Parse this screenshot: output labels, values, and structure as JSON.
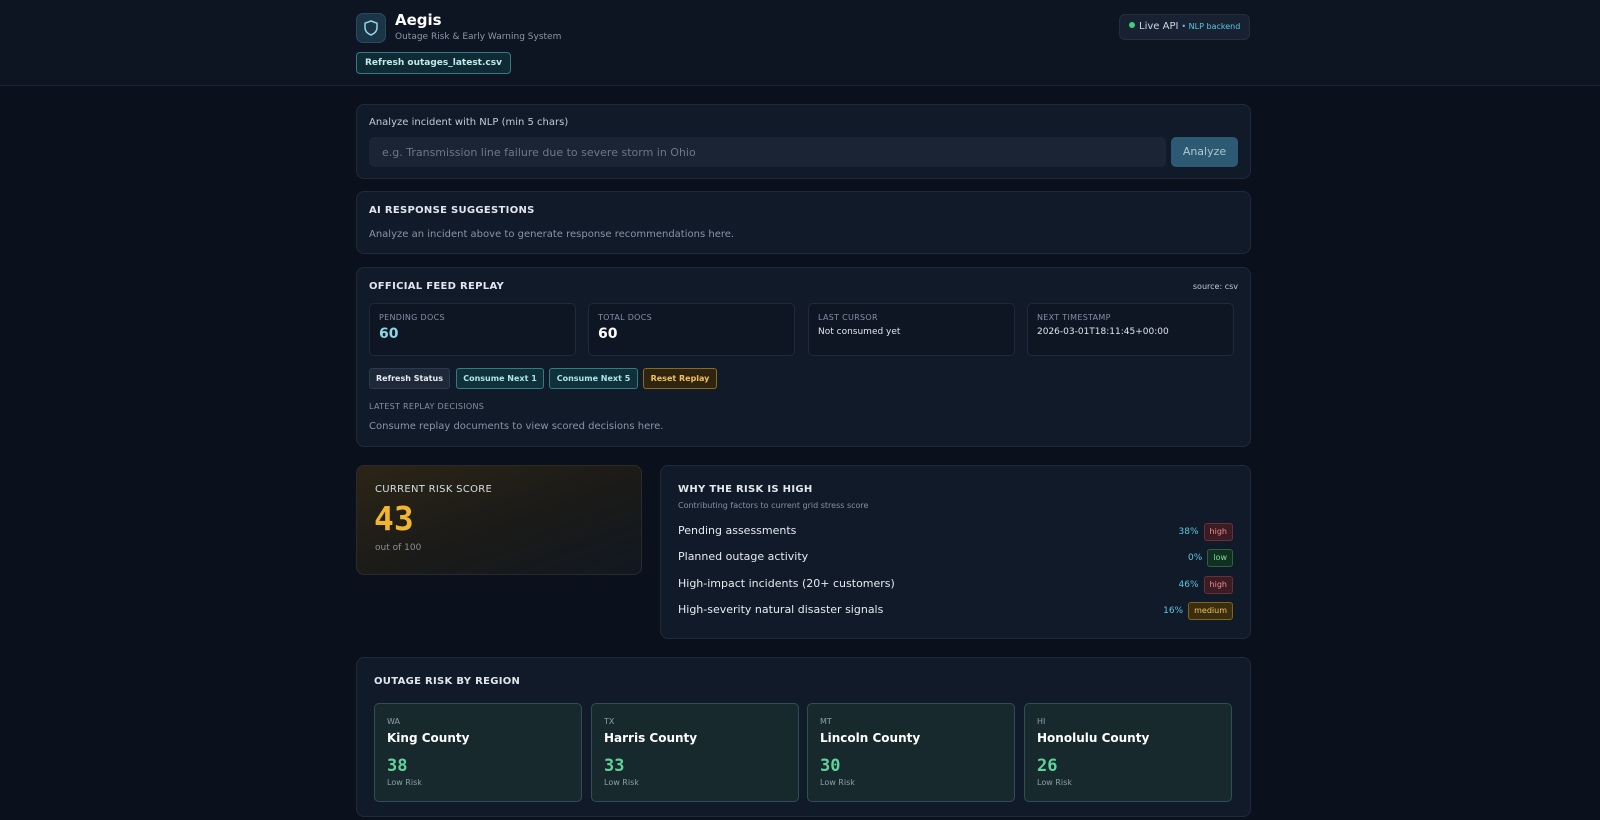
{
  "header": {
    "title": "Aegis",
    "subtitle": "Outage Risk & Early Warning System",
    "refresh_button": "Refresh outages_latest.csv",
    "api_status": "Live API",
    "api_backend": "• NLP backend",
    "logo_icon": "shield-icon"
  },
  "nlp": {
    "label": "Analyze incident with NLP (min 5 chars)",
    "placeholder": "e.g. Transmission line failure due to severe storm in Ohio",
    "value": "",
    "button": "Analyze"
  },
  "suggestions": {
    "title": "AI RESPONSE SUGGESTIONS",
    "empty_text": "Analyze an incident above to generate response recommendations here."
  },
  "feed": {
    "title": "OFFICIAL FEED REPLAY",
    "source": "source: csv",
    "stats": [
      {
        "label": "PENDING DOCS",
        "value": "60"
      },
      {
        "label": "TOTAL DOCS",
        "value": "60"
      },
      {
        "label": "LAST CURSOR",
        "value": "Not consumed yet"
      },
      {
        "label": "NEXT TIMESTAMP",
        "value": "2026-03-01T18:11:45+00:00"
      }
    ],
    "buttons": {
      "refresh": "Refresh Status",
      "next1": "Consume Next 1",
      "next5": "Consume Next 5",
      "reset": "Reset Replay"
    },
    "decisions_label": "LATEST REPLAY DECISIONS",
    "decisions_empty": "Consume replay documents to view scored decisions here."
  },
  "risk": {
    "title": "CURRENT RISK SCORE",
    "score": "43",
    "out_of": "out of 100",
    "score_color": "#f2b531"
  },
  "why": {
    "title": "WHY THE RISK IS HIGH",
    "subtitle": "Contributing factors to current grid stress score",
    "factors": [
      {
        "label": "Pending assessments",
        "pct": "38%",
        "level": "high"
      },
      {
        "label": "Planned outage activity",
        "pct": "0%",
        "level": "low"
      },
      {
        "label": "High-impact incidents (20+ customers)",
        "pct": "46%",
        "level": "high"
      },
      {
        "label": "High-severity natural disaster signals",
        "pct": "16%",
        "level": "medium"
      }
    ]
  },
  "regions": {
    "title": "OUTAGE RISK BY REGION",
    "items": [
      {
        "state": "WA",
        "name": "King County",
        "score": "38",
        "level": "Low Risk"
      },
      {
        "state": "TX",
        "name": "Harris County",
        "score": "33",
        "level": "Low Risk"
      },
      {
        "state": "MT",
        "name": "Lincoln County",
        "score": "30",
        "level": "Low Risk"
      },
      {
        "state": "HI",
        "name": "Honolulu County",
        "score": "26",
        "level": "Low Risk"
      }
    ]
  },
  "colors": {
    "accent_teal": "#5bc8e0",
    "risk_high": "#f08a96",
    "risk_low": "#5fd49a",
    "risk_medium": "#f2c15a"
  }
}
